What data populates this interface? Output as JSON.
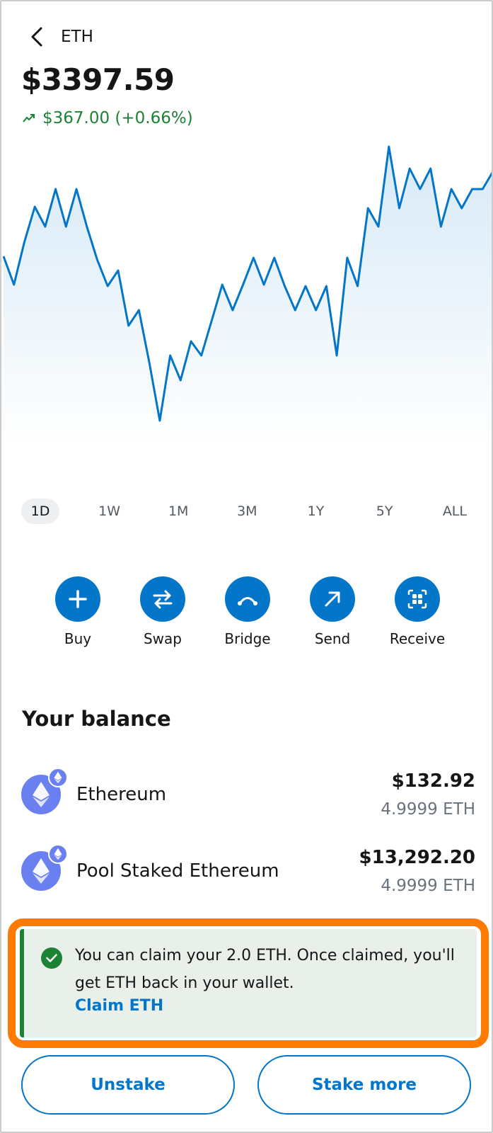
{
  "header": {
    "title": "ETH",
    "back_icon": "chevron-left-icon"
  },
  "price": {
    "value": "$3397.59",
    "change": "$367.00 (+0.66%)",
    "change_color": "#1c8234",
    "trend_icon": "trending-up-icon"
  },
  "chart_data": {
    "type": "area",
    "color": "#0376c9",
    "values": [
      360,
      400,
      340,
      290,
      318,
      265,
      318,
      265,
      318,
      365,
      402,
      380,
      458,
      436,
      510,
      592,
      500,
      535,
      480,
      500,
      450,
      400,
      436,
      400,
      362,
      400,
      362,
      402,
      436,
      402,
      436,
      402,
      500,
      362,
      402,
      292,
      318,
      205,
      292,
      236,
      265,
      236,
      318,
      265,
      292,
      265,
      265,
      240
    ]
  },
  "ranges": [
    "1D",
    "1W",
    "1M",
    "3M",
    "1Y",
    "5Y",
    "ALL"
  ],
  "active_range": "1D",
  "actions": [
    {
      "label": "Buy",
      "icon": "plus-icon"
    },
    {
      "label": "Swap",
      "icon": "swap-arrows-icon"
    },
    {
      "label": "Bridge",
      "icon": "bridge-icon"
    },
    {
      "label": "Send",
      "icon": "arrow-up-right-icon"
    },
    {
      "label": "Receive",
      "icon": "qr-code-icon"
    }
  ],
  "balance": {
    "title": "Your balance",
    "assets": [
      {
        "name": "Ethereum",
        "fiat": "$132.92",
        "amount": "4.9999 ETH",
        "icon": "ethereum-icon"
      },
      {
        "name": "Pool Staked Ethereum",
        "fiat": "$13,292.20",
        "amount": "4.9999 ETH",
        "icon": "ethereum-icon"
      }
    ]
  },
  "notice": {
    "text": "You can claim your 2.0 ETH. Once claimed, you'll get ETH back in your wallet.",
    "link": "Claim ETH",
    "icon": "check-circle-icon",
    "highlight_color": "#ff7a00"
  },
  "buttons": {
    "unstake": "Unstake",
    "stake_more": "Stake more"
  }
}
